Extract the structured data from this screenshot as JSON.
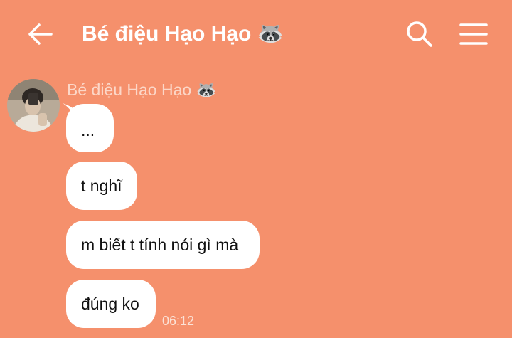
{
  "header": {
    "back_icon": "arrow-left-icon",
    "title": "Bé điệu Hạo Hạo 🦝",
    "search_icon": "search-icon",
    "menu_icon": "hamburger-menu-icon"
  },
  "conversation": {
    "sender_name": "Bé điệu Hạo Hạo 🦝",
    "messages": [
      {
        "text": "..."
      },
      {
        "text": "t nghĩ"
      },
      {
        "text": "m biết t tính nói gì mà"
      },
      {
        "text": "đúng ko"
      }
    ],
    "last_timestamp": "06:12"
  },
  "colors": {
    "background": "#f5906c",
    "bubble": "#ffffff",
    "sender_name": "#fcd7c8",
    "timestamp": "#fbe3d8"
  }
}
